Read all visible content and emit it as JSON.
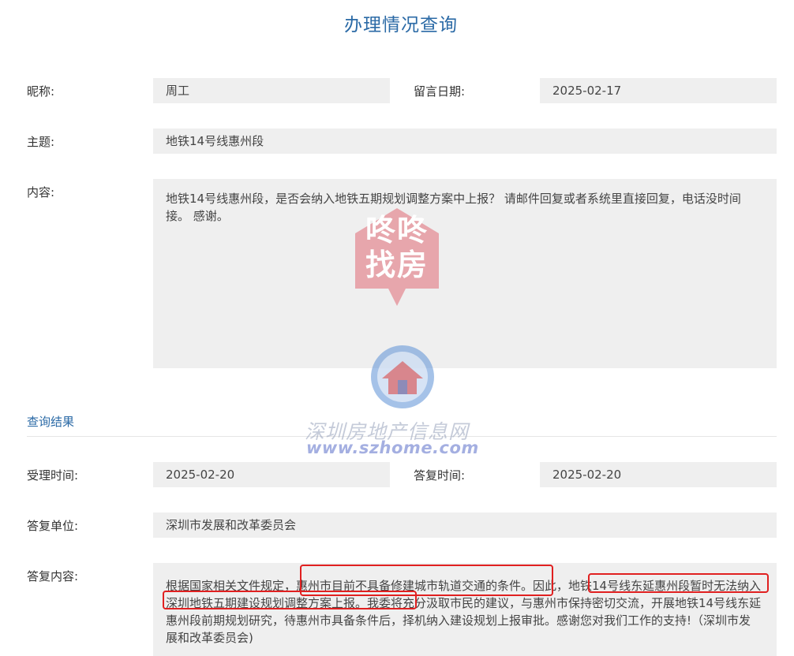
{
  "page_title": "办理情况查询",
  "form": {
    "nickname_label": "昵称:",
    "nickname_value": "周工",
    "message_date_label": "留言日期:",
    "message_date_value": "2025-02-17",
    "subject_label": "主题:",
    "subject_value": "地铁14号线惠州段",
    "content_label": "内容:",
    "content_value": "地铁14号线惠州段，是否会纳入地铁五期规划调整方案中上报？ 请邮件回复或者系统里直接回复，电话没时间接。 感谢。"
  },
  "result": {
    "section_title": "查询结果",
    "accept_time_label": "受理时间:",
    "accept_time_value": "2025-02-20",
    "reply_time_label": "答复时间:",
    "reply_time_value": "2025-02-20",
    "reply_unit_label": "答复单位:",
    "reply_unit_value": "深圳市发展和改革委员会",
    "reply_content_label": "答复内容:",
    "reply_content_value": "根据国家相关文件规定，惠州市目前不具备修建城市轨道交通的条件。因此，地铁14号线东延惠州段暂时无法纳入深圳地铁五期建设规划调整方案上报。我委将充分汲取市民的建议，与惠州市保持密切交流，开展地铁14号线东延惠州段前期规划研究，待惠州市具备条件后，择机纳入建设规划上报审批。感谢您对我们工作的支持!（深圳市发展和改革委员会)"
  },
  "watermark": {
    "house_text": "咚咚找房",
    "site_name": "深圳房地产信息网",
    "site_url": "www.szhome.com",
    "colors": {
      "house": "#e06a74",
      "logo_blue": "#5b8fd6",
      "logo_red": "#d94848"
    }
  }
}
